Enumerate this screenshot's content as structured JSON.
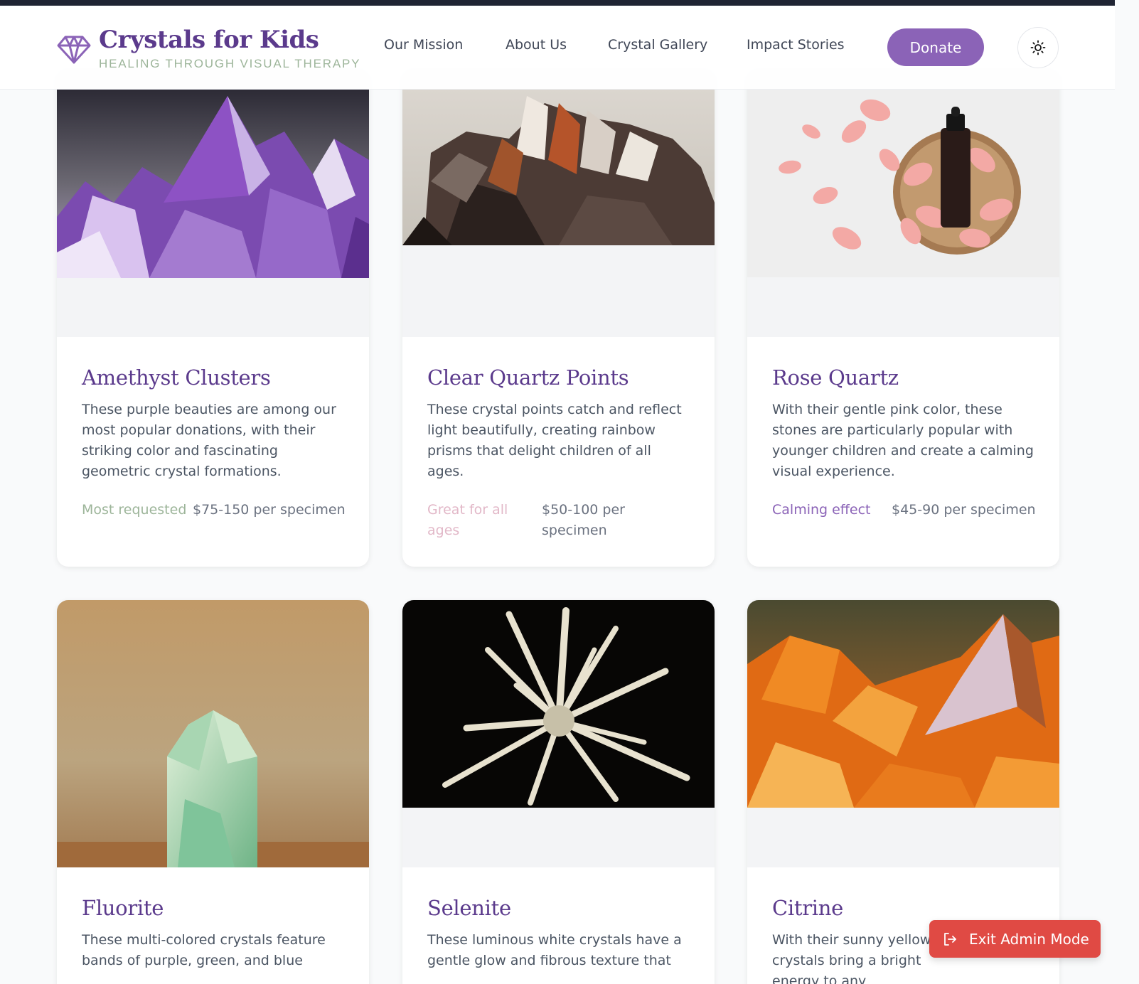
{
  "brand": {
    "title": "Crystals for Kids",
    "subtitle": "HEALING THROUGH VISUAL THERAPY",
    "logo_icon": "gem-icon",
    "accent_color": "#5b3a8c"
  },
  "nav": {
    "items": [
      {
        "label": "Our Mission"
      },
      {
        "label": "About Us"
      },
      {
        "label": "Crystal Gallery"
      },
      {
        "label": "Impact Stories"
      }
    ],
    "donate_label": "Donate",
    "theme_icon": "sun-icon"
  },
  "cards": [
    {
      "title": "Amethyst Clusters",
      "description": "These purple beauties are among our most popular donations, with their striking color and fascinating geometric crystal formations.",
      "tag": "Most requested",
      "tag_color": "#9db59a",
      "price": "$75-150 per specimen"
    },
    {
      "title": "Clear Quartz Points",
      "description": "These crystal points catch and reflect light beautifully, creating rainbow prisms that delight children of all ages.",
      "tag": "Great for all ages",
      "tag_color": "#e2b8c8",
      "price": "$50-100 per specimen"
    },
    {
      "title": "Rose Quartz",
      "description": "With their gentle pink color, these stones are particularly popular with younger children and create a calming visual experience.",
      "tag": "Calming effect",
      "tag_color": "#8b63b7",
      "price": "$45-90 per specimen"
    },
    {
      "title": "Fluorite",
      "description": "These multi-colored crystals feature bands of purple, green, and blue"
    },
    {
      "title": "Selenite",
      "description": "These luminous white crystals have a gentle glow and fibrous texture that"
    },
    {
      "title": "Citrine",
      "description": "With their sunny yellow crystals bring a bright energy to any"
    }
  ],
  "admin": {
    "exit_label": "Exit Admin Mode",
    "exit_icon": "logout-icon",
    "button_color": "#e04a44"
  }
}
